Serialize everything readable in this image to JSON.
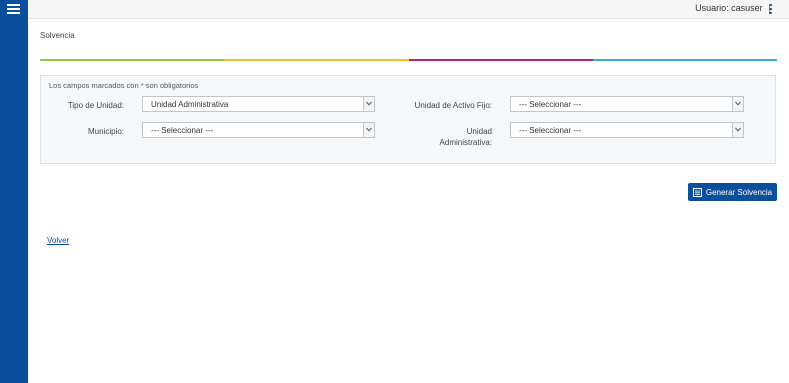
{
  "topbar": {
    "user_label": "Usuario: casuser",
    "separator": "|"
  },
  "page": {
    "title": "Solvencia"
  },
  "stripe_colors": [
    "#8dc63f",
    "#f7c02b",
    "#b3286b",
    "#3aa9dc"
  ],
  "form": {
    "required_note": "Los campos marcados con * son obligatorios",
    "tipo_unidad": {
      "label": "Tipo de Unidad:",
      "value": "Unidad Administrativa"
    },
    "unidad_activo_fijo": {
      "label": "Unidad de Activo Fijo:",
      "value": "--- Seleccionar ---"
    },
    "municipio": {
      "label": "Municipio:",
      "value": "--- Seleccionar ---"
    },
    "unidad_administrativa": {
      "label_line1": "Unidad",
      "label_line2": "Administrativa:",
      "value": "--- Seleccionar ---"
    }
  },
  "actions": {
    "generate_label": "Generar Solvencia",
    "generate_icon": "document-icon",
    "back_label": "Volver"
  },
  "icons": {
    "menu": "hamburger-icon",
    "more": "kebab-icon",
    "dropdown": "chevron-down-icon"
  },
  "colors": {
    "primary": "#0a4f9c"
  }
}
